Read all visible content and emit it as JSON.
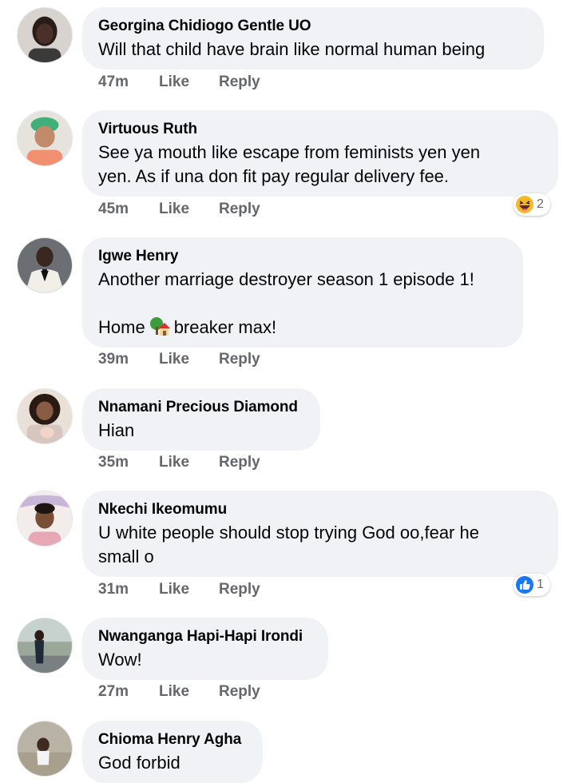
{
  "comments": [
    {
      "name": "Georgina Chidiogo Gentle UO",
      "text": "Will that child have brain like normal human being",
      "time": "47m",
      "like": "Like",
      "reply": "Reply"
    },
    {
      "name": "Virtuous Ruth",
      "line1": "See ya mouth like escape from feminists yen yen",
      "line2": "yen. As if una don fit pay regular delivery fee.",
      "time": "45m",
      "like": "Like",
      "reply": "Reply",
      "reaction_count": "2"
    },
    {
      "name": "Igwe Henry",
      "line1": "Another marriage destroyer season 1 episode 1!",
      "line2a": "Home",
      "line2b": "breaker max!",
      "time": "39m",
      "like": "Like",
      "reply": "Reply"
    },
    {
      "name": "Nnamani Precious Diamond",
      "text": "Hian",
      "time": "35m",
      "like": "Like",
      "reply": "Reply"
    },
    {
      "name": "Nkechi Ikeomumu",
      "line1": "U white people should stop trying God oo,fear he",
      "line2": "small o",
      "time": "31m",
      "like": "Like",
      "reply": "Reply",
      "reaction_count": "1"
    },
    {
      "name": "Nwanganga Hapi-Hapi Irondi",
      "text": "Wow!",
      "time": "27m",
      "like": "Like",
      "reply": "Reply"
    },
    {
      "name": "Chioma Henry Agha",
      "text": "God forbid"
    }
  ],
  "colors": {
    "bubble": "#f0f2f5",
    "meta": "#65676b",
    "like_blue": "#1877f2",
    "haha_yellow": "#f7b928"
  },
  "icons": {
    "haha": "haha-reaction-icon",
    "like": "like-reaction-icon",
    "house": "house-with-tree-emoji"
  }
}
